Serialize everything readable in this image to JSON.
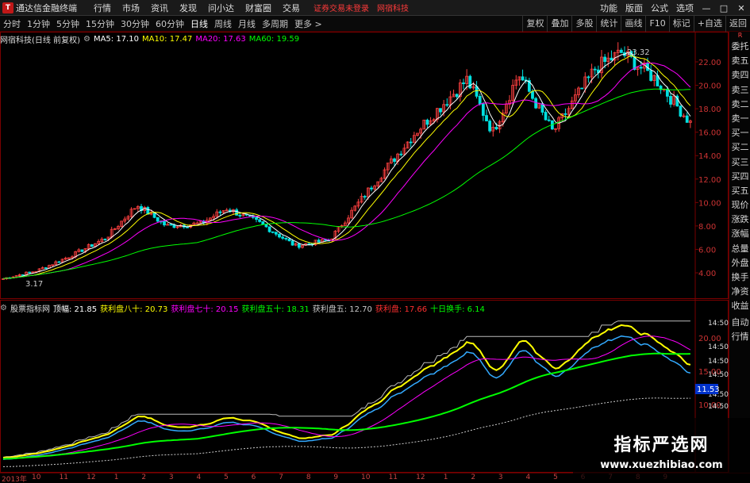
{
  "menubar": {
    "app_title": "通达信金融终端",
    "items": [
      "行情",
      "市场",
      "资讯",
      "发现",
      "问小达",
      "财富圈",
      "交易"
    ],
    "alert": "证券交易未登录",
    "alert_stock": "网宿科技",
    "right_items": [
      "功能",
      "版面",
      "公式",
      "选项"
    ],
    "win_buttons": [
      "—",
      "□",
      "✕"
    ]
  },
  "toolbar": {
    "periods": [
      "分时",
      "1分钟",
      "5分钟",
      "15分钟",
      "30分钟",
      "60分钟",
      "日线",
      "周线",
      "月线",
      "多周期",
      "更多 >"
    ],
    "active_index": 6,
    "right_buttons": [
      "复权",
      "叠加",
      "多股",
      "统计",
      "画线",
      "F10",
      "标记",
      "+自选",
      "返回"
    ]
  },
  "main_chart": {
    "stock_label": "网宿科技(日线 前复权)",
    "ma": [
      {
        "label": "MA5: 17.10",
        "color": "#ffffff"
      },
      {
        "label": "MA10: 17.47",
        "color": "#ffff00"
      },
      {
        "label": "MA20: 17.63",
        "color": "#ff00ff"
      },
      {
        "label": "MA60: 19.59",
        "color": "#00ff00"
      }
    ],
    "y_ticks": [
      "22.00",
      "20.00",
      "18.00",
      "16.00",
      "14.00",
      "12.00",
      "10.00",
      "8.00",
      "6.00",
      "4.00"
    ],
    "high_label": "23.32",
    "low_label": "3.17"
  },
  "sub_chart": {
    "indicator_name": "股票指标网",
    "items": [
      {
        "label": "顶幅: 21.85",
        "color": "#ffffff"
      },
      {
        "label": "获利盘八十: 20.73",
        "color": "#ffff00"
      },
      {
        "label": "获利盘七十: 20.15",
        "color": "#ff00ff"
      },
      {
        "label": "获利盘五十: 18.31",
        "color": "#00ff00"
      },
      {
        "label": "获利盘五: 12.70",
        "color": "#c8c8c8"
      },
      {
        "label": "获利盘: 17.66",
        "color": "#ff3030"
      },
      {
        "label": "十日换手: 6.14",
        "color": "#00ff00"
      }
    ],
    "y_ticks": [
      "20.00",
      "15.00",
      "10.00"
    ],
    "right_labels": [
      "14:50",
      "14:50",
      "14:50",
      "14:50",
      "14:50",
      "14:50"
    ],
    "current_value": "11.53"
  },
  "side_panel": {
    "top_mark": "R",
    "items": [
      "委托",
      "卖五",
      "卖四",
      "卖三",
      "卖二",
      "卖一",
      "买一",
      "买二",
      "买三",
      "买四",
      "买五",
      "现价",
      "涨跌",
      "涨幅",
      "总量",
      "外盘",
      "换手",
      "净资",
      "收益"
    ],
    "lower_items": [
      "自动",
      "行情"
    ]
  },
  "date_axis": {
    "year_label": "2013年",
    "ticks": [
      "10",
      "11",
      "12",
      "1",
      "2",
      "3",
      "4",
      "5",
      "6",
      "7",
      "8",
      "9",
      "10",
      "11",
      "12",
      "1",
      "2",
      "3",
      "4",
      "5",
      "6",
      "7",
      "8",
      "9"
    ]
  },
  "watermark": {
    "title": "指标严选网",
    "url": "www.xuezhibiao.com"
  }
}
